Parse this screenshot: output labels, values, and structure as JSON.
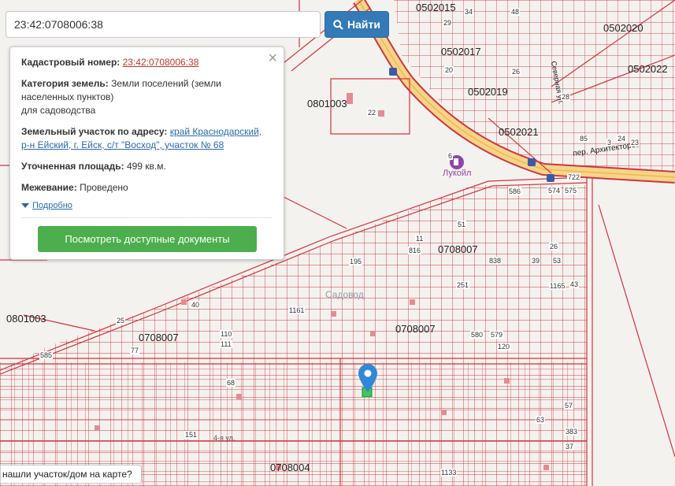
{
  "search": {
    "value": "23:42:0708006:38",
    "button_label": "Найти"
  },
  "info": {
    "cadastral_label": "Кадастровый номер:",
    "cadastral_value": "23:42:0708006:38",
    "category_label": "Категория земель:",
    "category_value": "Земли поселений (земли населенных пунктов)",
    "category_use": "для садоводства",
    "address_label": "Земельный участок по адресу:",
    "address_value": "край Краснодарский, р-н Ейский, г. Ейск, с/т \"Восход\", участок № 68",
    "area_label": "Уточненная площадь:",
    "area_value": "499 кв.м.",
    "survey_label": "Межевание:",
    "survey_value": "Проведено",
    "more_link": "Подробно",
    "docs_button": "Посмотреть доступные документы"
  },
  "bottom_tip": "нашли участок/дом на карте?",
  "map": {
    "labels": {
      "q0502015": "0502015",
      "q0502017": "0502017",
      "q0502019": "0502019",
      "q0502020": "0502020",
      "q0502021": "0502021",
      "q0502022": "0502022",
      "q0801003a": "0801003",
      "q0801003b": "0801003",
      "q0708007a": "0708007",
      "q0708007b": "0708007",
      "q0708007c": "0708007",
      "q0708004": "0708004",
      "sadovod": "Садовод",
      "lukoil": "Лукойл",
      "street_arch": "пер. Архитекторов",
      "street_4": "4-я ул.",
      "street_sev": "Северная ул."
    },
    "numbers": [
      "22",
      "34",
      "29",
      "48",
      "26",
      "28",
      "20",
      "85",
      "24",
      "23",
      "3",
      "6",
      "722",
      "574",
      "575",
      "586",
      "51",
      "816",
      "11",
      "838",
      "39",
      "53",
      "26",
      "195",
      "1165",
      "43",
      "251",
      "580",
      "579",
      "120",
      "40",
      "25",
      "1161",
      "110",
      "111",
      "77",
      "585",
      "68",
      "57",
      "63",
      "383",
      "37",
      "1133",
      "151"
    ]
  },
  "colors": {
    "parcel": "#d1343f",
    "road": "#f5d58a",
    "map_bg": "#f4f2ee",
    "button_blue": "#337ab7",
    "button_green": "#4cae4c",
    "pin": "#2f89d8"
  }
}
